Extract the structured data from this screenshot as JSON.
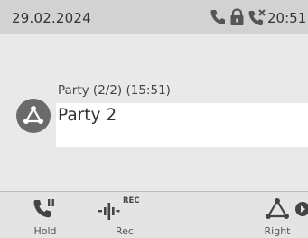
{
  "statusbar": {
    "date": "29.02.2024",
    "time": "20:51",
    "icons": [
      "handset-icon",
      "lock-icon",
      "missed-call-icon"
    ]
  },
  "call": {
    "label": "Party (2/2) (15:51)",
    "name": "Party 2",
    "avatar_icon": "conference-icon"
  },
  "softkeys": [
    {
      "label": "Hold",
      "icon": "hold-icon"
    },
    {
      "label": "Rec",
      "icon": "record-icon",
      "badge": "REC"
    },
    {
      "label": "Right",
      "icon": "conference-icon"
    },
    {
      "label": "",
      "icon": "play-arrow-icon"
    }
  ],
  "colors": {
    "statusbar": "#d2d2d2",
    "background": "#e9e9e9",
    "avatar": "#6a6a6a",
    "text": "#333333"
  }
}
